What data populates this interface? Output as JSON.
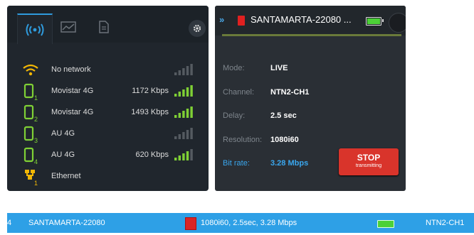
{
  "network": {
    "tabs": [
      {
        "name": "connections",
        "icon": "wifi-broadcast-icon"
      },
      {
        "name": "statistics",
        "icon": "chart-icon"
      },
      {
        "name": "logs",
        "icon": "document-icon"
      }
    ],
    "settings_icon": "gear-icon",
    "rows": [
      {
        "icon": "wifi-icon",
        "index": "",
        "name": "No network",
        "rate": "",
        "signal_bars": 0,
        "color": "#f2b705"
      },
      {
        "icon": "modem-icon",
        "index": "1",
        "name": "Movistar 4G",
        "rate": "1172 Kbps",
        "signal_bars": 5,
        "color": "#7fd035"
      },
      {
        "icon": "modem-icon",
        "index": "2",
        "name": "Movistar 4G",
        "rate": "1493 Kbps",
        "signal_bars": 5,
        "color": "#7fd035"
      },
      {
        "icon": "modem-icon",
        "index": "3",
        "name": "AU 4G",
        "rate": "",
        "signal_bars": 0,
        "color": "#7fd035"
      },
      {
        "icon": "modem-icon",
        "index": "4",
        "name": "AU 4G",
        "rate": "620 Kbps",
        "signal_bars": 4,
        "color": "#7fd035"
      },
      {
        "icon": "ethernet-icon",
        "index": "1",
        "name": "Ethernet",
        "rate": "",
        "signal_bars": null,
        "color": "#f2b705"
      }
    ]
  },
  "device": {
    "title": "SANTAMARTA-22080 ...",
    "battery_level": 1.0,
    "fields": [
      {
        "label": "Mode:",
        "value": "LIVE",
        "highlight": false
      },
      {
        "label": "Channel:",
        "value": "NTN2-CH1",
        "highlight": false
      },
      {
        "label": "Delay:",
        "value": "2.5 sec",
        "highlight": false
      },
      {
        "label": "Resolution:",
        "value": "1080i60",
        "highlight": false
      },
      {
        "label": "Bit rate:",
        "value": "3.28 Mbps",
        "highlight": true
      }
    ],
    "stop_button": {
      "title": "STOP",
      "subtitle": "transmitting"
    }
  },
  "list_row": {
    "index": "4",
    "name": "SANTAMARTA-22080",
    "info": "1080i60, 2.5sec, 3.28 Mbps",
    "battery_level": 1.0,
    "channel": "NTN2-CH1"
  },
  "colors": {
    "accent_blue": "#2ea0e6",
    "signal_green": "#7fd035",
    "signal_off": "#555b61",
    "warning_yellow": "#f2b705",
    "stop_red": "#d9342b",
    "highlight_text": "#3aa7ee"
  }
}
